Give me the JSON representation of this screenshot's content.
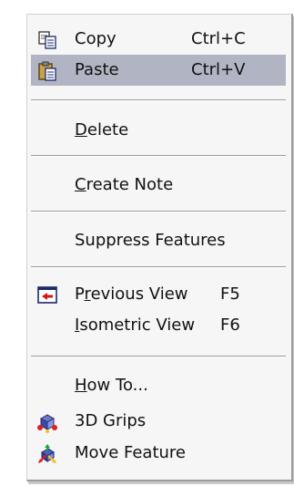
{
  "menu": {
    "items": [
      {
        "id": "copy",
        "label": "Copy",
        "hotkey_prefix": "",
        "hotkey": "",
        "rest": "Copy",
        "shortcut": "Ctrl+C",
        "icon": "copy-icon"
      },
      {
        "id": "paste",
        "label": "Paste",
        "rest": "Paste",
        "shortcut": "Ctrl+V",
        "icon": "paste-icon",
        "highlighted": true
      },
      {
        "id": "delete",
        "hotkey": "D",
        "rest": "elete"
      },
      {
        "id": "create-note",
        "hotkey": "C",
        "rest": "reate Note"
      },
      {
        "id": "suppress-features",
        "label": "Suppress Features"
      },
      {
        "id": "previous-view",
        "prefix": "P",
        "hotkey": "r",
        "rest": "evious View",
        "shortcut": "F5",
        "icon": "previous-view-icon"
      },
      {
        "id": "isometric-view",
        "hotkey": "I",
        "rest": "sometric View",
        "shortcut": "F6"
      },
      {
        "id": "how-to",
        "hotkey": "H",
        "rest": "ow To..."
      },
      {
        "id": "3d-grips",
        "label": "3D Grips",
        "icon": "3d-grips-icon"
      },
      {
        "id": "move-feature",
        "label": "Move Feature",
        "icon": "move-feature-icon"
      }
    ]
  },
  "colors": {
    "highlight": "#b1b5c3",
    "menu_background": "#f6f6f6",
    "separator": "#9a9a9a"
  }
}
